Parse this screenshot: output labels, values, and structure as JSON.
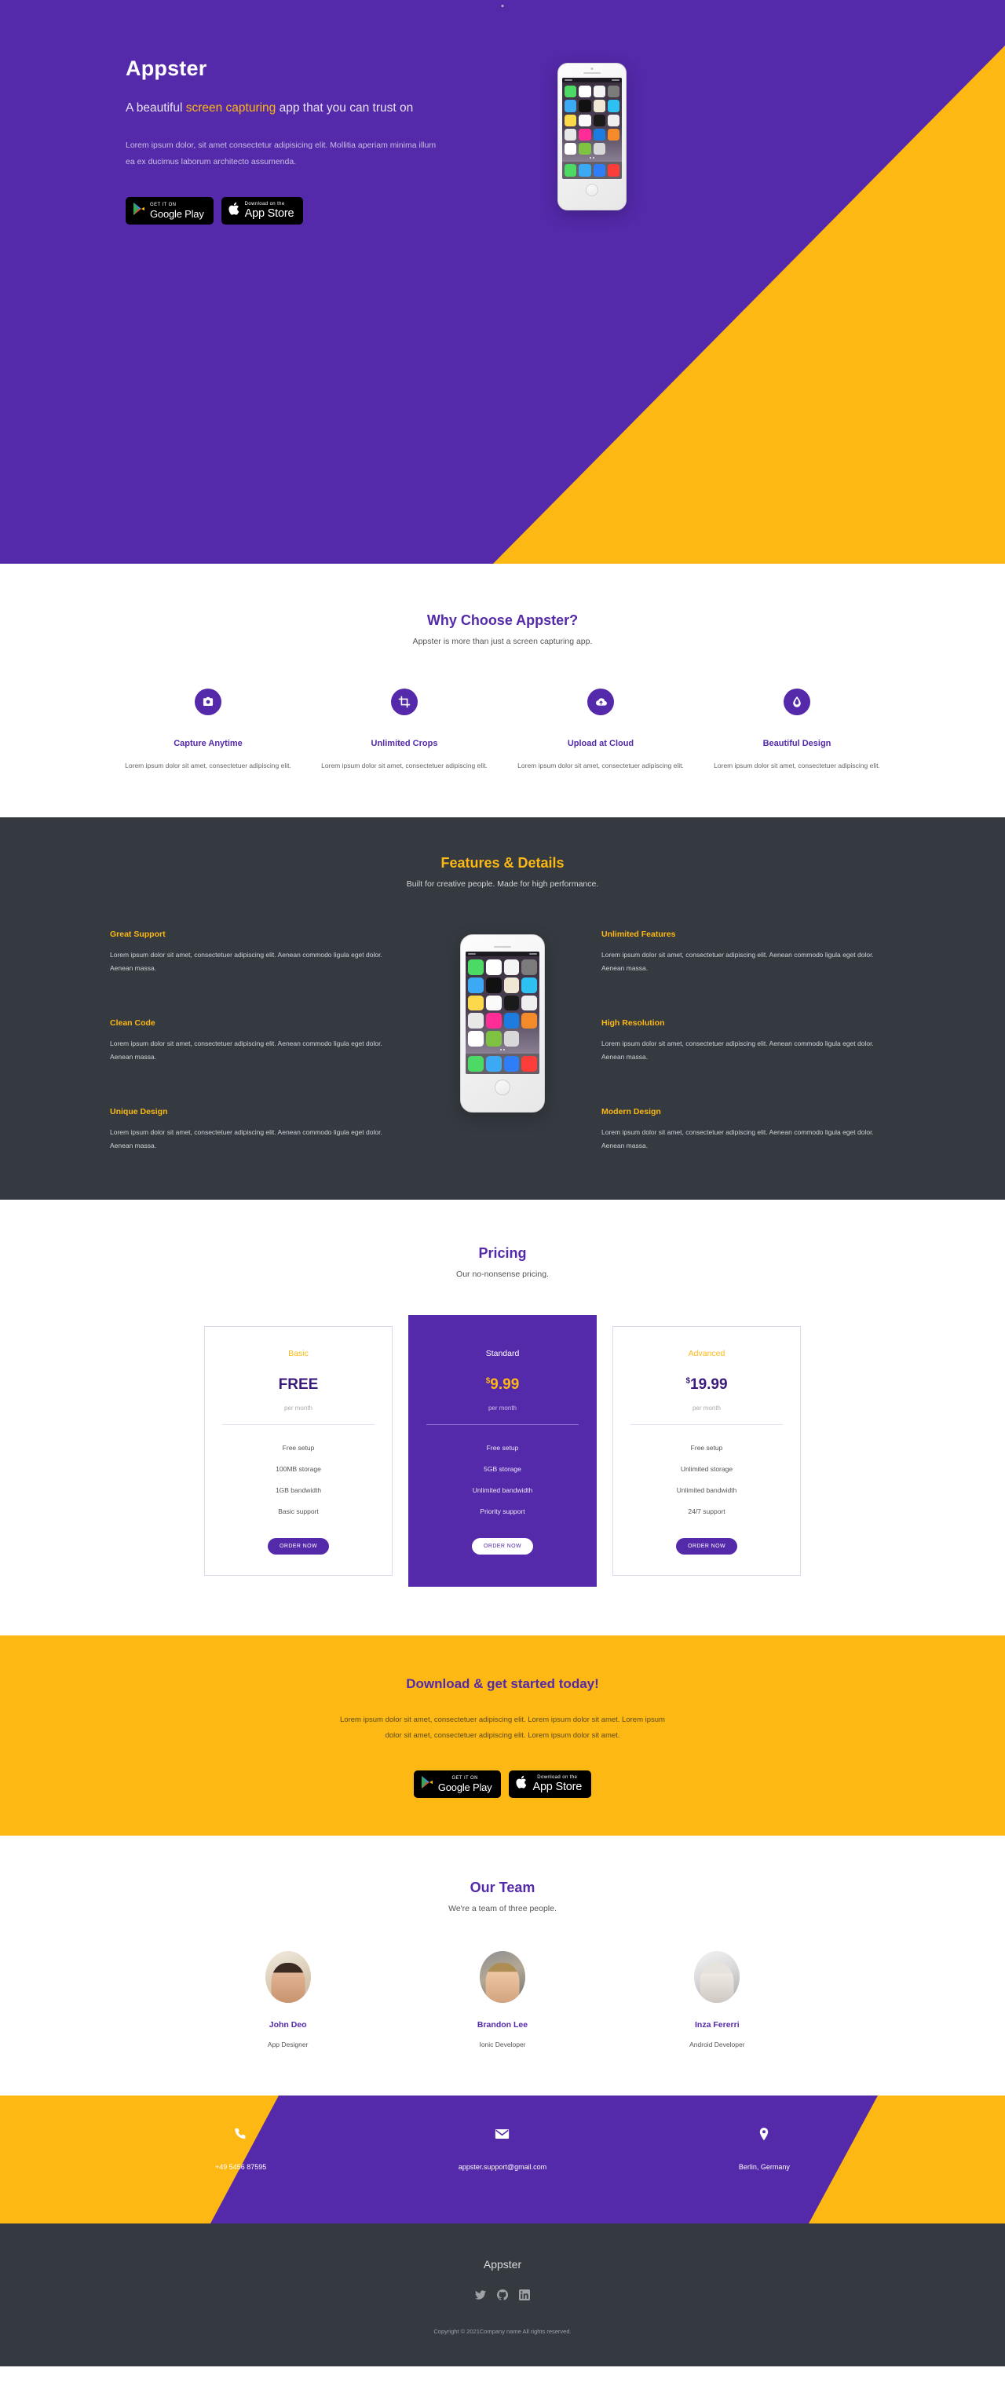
{
  "hero": {
    "title": "Appster",
    "subtitle_pre": "A beautiful ",
    "subtitle_highlight": "screen capturing",
    "subtitle_post": " app that you can trust on",
    "description": "Lorem ipsum dolor, sit amet consectetur adipisicing elit. Mollitia aperiam minima illum ea ex ducimus laborum architecto assumenda.",
    "google_play_top": "GET IT ON",
    "google_play_bottom": "Google Play",
    "app_store_top": "Download on the",
    "app_store_bottom": "App Store"
  },
  "why": {
    "title": "Why Choose Appster?",
    "subtitle": "Appster is more than just a screen capturing app.",
    "items": [
      {
        "icon": "camera-icon",
        "name": "Capture Anytime",
        "text": "Lorem ipsum dolor sit amet, consectetuer adipiscing elit."
      },
      {
        "icon": "crop-icon",
        "name": "Unlimited Crops",
        "text": "Lorem ipsum dolor sit amet, consectetuer adipiscing elit."
      },
      {
        "icon": "cloud-upload-icon",
        "name": "Upload at Cloud",
        "text": "Lorem ipsum dolor sit amet, consectetuer adipiscing elit."
      },
      {
        "icon": "droplet-icon",
        "name": "Beautiful Design",
        "text": "Lorem ipsum dolor sit amet, consectetuer adipiscing elit."
      }
    ]
  },
  "features": {
    "title": "Features & Details",
    "subtitle": "Built for creative people. Made for high performance.",
    "left": [
      {
        "name": "Great Support",
        "text": "Lorem ipsum dolor sit amet, consectetuer adipiscing elit. Aenean commodo ligula eget dolor. Aenean massa."
      },
      {
        "name": "Clean Code",
        "text": "Lorem ipsum dolor sit amet, consectetuer adipiscing elit. Aenean commodo ligula eget dolor. Aenean massa."
      },
      {
        "name": "Unique Design",
        "text": "Lorem ipsum dolor sit amet, consectetuer adipiscing elit. Aenean commodo ligula eget dolor. Aenean massa."
      }
    ],
    "right": [
      {
        "name": "Unlimited Features",
        "text": "Lorem ipsum dolor sit amet, consectetuer adipiscing elit. Aenean commodo ligula eget dolor. Aenean massa."
      },
      {
        "name": "High Resolution",
        "text": "Lorem ipsum dolor sit amet, consectetuer adipiscing elit. Aenean commodo ligula eget dolor. Aenean massa."
      },
      {
        "name": "Modern Design",
        "text": "Lorem ipsum dolor sit amet, consectetuer adipiscing elit. Aenean commodo ligula eget dolor. Aenean massa."
      }
    ]
  },
  "pricing": {
    "title": "Pricing",
    "subtitle": "Our no-nonsense pricing.",
    "plans": [
      {
        "name": "Basic",
        "currency": "",
        "price": "FREE",
        "period": "per month",
        "features": [
          "Free setup",
          "100MB storage",
          "1GB bandwidth",
          "Basic support"
        ],
        "cta": "ORDER NOW"
      },
      {
        "name": "Standard",
        "currency": "$",
        "price": "9.99",
        "period": "per month",
        "features": [
          "Free setup",
          "5GB storage",
          "Unlimited bandwidth",
          "Priority support"
        ],
        "cta": "ORDER NOW"
      },
      {
        "name": "Advanced",
        "currency": "$",
        "price": "19.99",
        "period": "per month",
        "features": [
          "Free setup",
          "Unlimited storage",
          "Unlimited bandwidth",
          "24/7 support"
        ],
        "cta": "ORDER NOW"
      }
    ]
  },
  "cta": {
    "title": "Download & get started today!",
    "text": "Lorem ipsum dolor sit amet, consectetuer adipiscing elit. Lorem ipsum dolor sit amet. Lorem ipsum dolor sit amet, consectetuer adipiscing elit. Lorem ipsum dolor sit amet.",
    "google_play_top": "GET IT ON",
    "google_play_bottom": "Google Play",
    "app_store_top": "Download on the",
    "app_store_bottom": "App Store"
  },
  "team": {
    "title": "Our Team",
    "subtitle": "We're a team of three people.",
    "members": [
      {
        "name": "John Deo",
        "role": "App Designer"
      },
      {
        "name": "Brandon Lee",
        "role": "Ionic Developer"
      },
      {
        "name": "Inza Fererri",
        "role": "Android Developer"
      }
    ]
  },
  "contact": {
    "phone_icon": "phone-icon",
    "phone": "+49 5456 87595",
    "email_icon": "envelope-icon",
    "email": "appster.support@gmail.com",
    "location_icon": "map-pin-icon",
    "location": "Berlin, Germany"
  },
  "footer": {
    "brand": "Appster",
    "social": [
      "twitter-icon",
      "github-icon",
      "linkedin-icon"
    ],
    "copyright": "Copyright © 2021Company name All rights reserved."
  },
  "colors": {
    "purple": "#5429aa",
    "yellow": "#fdb813",
    "dark": "#343a40"
  }
}
